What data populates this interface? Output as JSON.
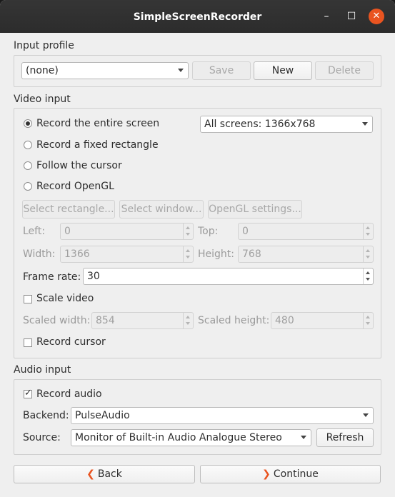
{
  "window": {
    "title": "SimpleScreenRecorder",
    "min_icon": "–",
    "max_icon": "☐",
    "close_icon": "✕"
  },
  "input_profile": {
    "label": "Input profile",
    "profile_value": "(none)",
    "save_label": "Save",
    "new_label": "New",
    "delete_label": "Delete"
  },
  "video_input": {
    "label": "Video input",
    "radio_entire_screen": "Record the entire screen",
    "radio_fixed_rect": "Record a fixed rectangle",
    "radio_follow_cursor": "Follow the cursor",
    "radio_opengl": "Record OpenGL",
    "selected_radio": "entire_screen",
    "screens_value": "All screens: 1366x768",
    "select_rect_label": "Select rectangle...",
    "select_window_label": "Select window...",
    "opengl_settings_label": "OpenGL settings...",
    "left_label": "Left:",
    "left_value": "0",
    "top_label": "Top:",
    "top_value": "0",
    "width_label": "Width:",
    "width_value": "1366",
    "height_label": "Height:",
    "height_value": "768",
    "frame_rate_label": "Frame rate:",
    "frame_rate_value": "30",
    "scale_video_label": "Scale video",
    "scale_video_checked": false,
    "scaled_width_label": "Scaled width:",
    "scaled_width_value": "854",
    "scaled_height_label": "Scaled height:",
    "scaled_height_value": "480",
    "record_cursor_label": "Record cursor",
    "record_cursor_checked": false
  },
  "audio_input": {
    "label": "Audio input",
    "record_audio_label": "Record audio",
    "record_audio_checked": true,
    "check_mark": "✓",
    "backend_label": "Backend:",
    "backend_value": "PulseAudio",
    "source_label": "Source:",
    "source_value": "Monitor of Built-in Audio Analogue Stereo",
    "refresh_label": "Refresh"
  },
  "nav": {
    "back_label": "Back",
    "back_icon": "❮",
    "continue_label": "Continue",
    "continue_icon": "❯"
  },
  "colors": {
    "accent": "#e95420",
    "titlebar": "#2f2f2f",
    "background": "#efefef"
  }
}
